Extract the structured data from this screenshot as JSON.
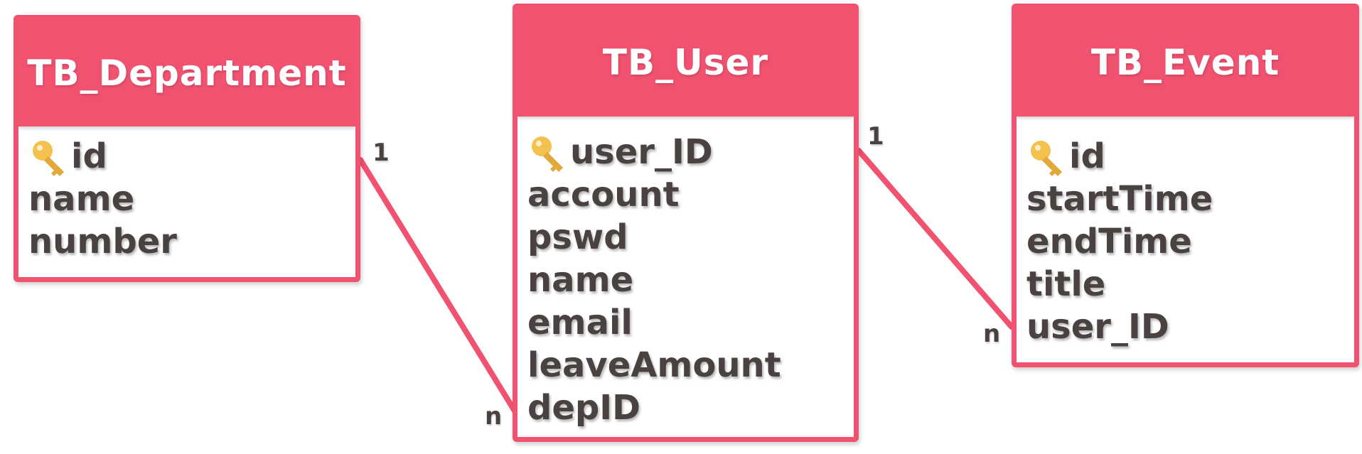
{
  "tables": {
    "department": {
      "title": "TB_Department",
      "fields": [
        "id",
        "name",
        "number"
      ]
    },
    "user": {
      "title": "TB_User",
      "fields": [
        "user_ID",
        "account",
        "pswd",
        "name",
        "email",
        "leaveAmount",
        "depID"
      ]
    },
    "event": {
      "title": "TB_Event",
      "fields": [
        "id",
        "startTime",
        "endTime",
        "title",
        "user_ID"
      ]
    }
  },
  "relations": {
    "department_user": {
      "one": "1",
      "many": "n"
    },
    "user_event": {
      "one": "1",
      "many": "n"
    }
  },
  "colors": {
    "accent": "#f05270",
    "text": "#4a4240",
    "key": "#f2c14e"
  },
  "icons": {
    "primary_key": "key-icon"
  }
}
